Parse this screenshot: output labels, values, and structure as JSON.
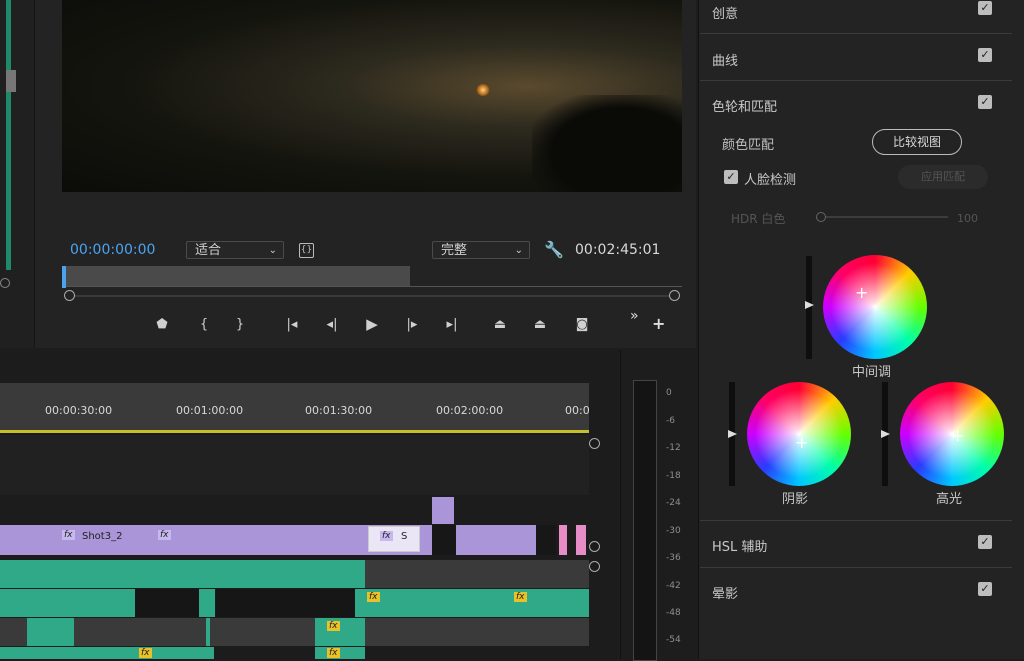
{
  "monitor": {
    "current_timecode": "00:00:00:00",
    "fit_select": "适合",
    "quality_select": "完整",
    "duration_timecode": "00:02:45:01",
    "more_symbol": "»"
  },
  "timeline": {
    "ruler_labels": [
      "00:00:30:00",
      "00:01:00:00",
      "00:01:30:00",
      "00:02:00:00",
      "00:0"
    ],
    "clips": {
      "shot_label": "Shot3_2",
      "short_label": "S",
      "fx_label": "fx"
    }
  },
  "meters": {
    "labels": [
      "0",
      "-6",
      "-12",
      "-18",
      "-24",
      "-30",
      "-36",
      "-42",
      "-48",
      "-54"
    ]
  },
  "lumetri": {
    "sections": {
      "creative": "创意",
      "curves": "曲线",
      "color_wheels": "色轮和匹配",
      "hsl": "HSL 辅助",
      "vignette": "晕影"
    },
    "color_match_label": "颜色匹配",
    "compare_view_button": "比较视图",
    "face_detect_label": "人脸检测",
    "apply_match_button": "应用匹配",
    "hdr_white_label": "HDR 白色",
    "hdr_white_value": "100",
    "wheels": {
      "midtones": "中间调",
      "shadows": "阴影",
      "highlights": "高光"
    }
  }
}
